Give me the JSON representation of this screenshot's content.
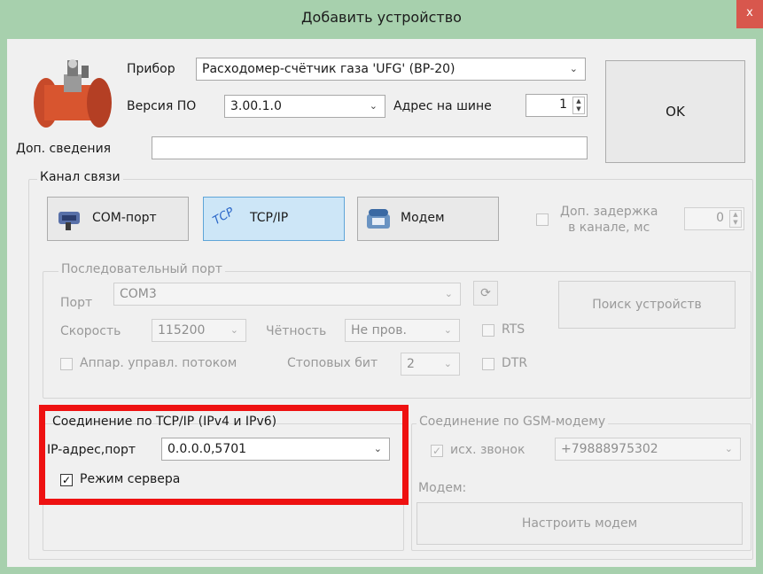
{
  "window": {
    "title": "Добавить устройство",
    "close_glyph": "x"
  },
  "device": {
    "label": "Прибор",
    "value": "Расходомер-счётчик газа 'UFG' (ВР-20)",
    "image_icon": "gas-flowmeter-image"
  },
  "firmware": {
    "label": "Версия ПО",
    "value": "3.00.1.0"
  },
  "bus_address": {
    "label": "Адрес на шине",
    "value": "1"
  },
  "ok_button": {
    "label": "OK"
  },
  "extra_info": {
    "label": "Доп. сведения",
    "value": ""
  },
  "channel": {
    "title": "Канал связи",
    "buttons": [
      {
        "label": "COM-порт",
        "icon": "serial-port-icon"
      },
      {
        "label": "TCP/IP",
        "icon": "tcp-icon",
        "icon_text": "TCP",
        "selected": true
      },
      {
        "label": "Модем",
        "icon": "phone-icon"
      }
    ],
    "delay": {
      "label_line1": "Доп. задержка",
      "label_line2": "в канале, мс",
      "value": "0",
      "checked": false
    }
  },
  "serial": {
    "title": "Последовательный порт",
    "port_label": "Порт",
    "port_value": "COM3",
    "speed_label": "Скорость",
    "speed_value": "115200",
    "parity_label": "Чётность",
    "parity_value": "Не пров.",
    "rts_label": "RTS",
    "flow_label": "Аппар. управл. потоком",
    "stop_label": "Стоповых бит",
    "stop_value": "2",
    "dtr_label": "DTR",
    "search_button": "Поиск устройств"
  },
  "tcp": {
    "title": "Соединение по TCP/IP (IPv4 и IPv6)",
    "ip_label": "IP-адрес,порт",
    "ip_value": "0.0.0.0,5701",
    "server_mode_label": "Режим сервера",
    "server_mode_checked": true
  },
  "gsm": {
    "title": "Соединение по GSM-модему",
    "outgoing_label": "исх. звонок",
    "outgoing_checked": true,
    "phone_value": "+79888975302",
    "modem_label": "Модем:",
    "setup_button": "Настроить модем"
  },
  "colors": {
    "titlebar": "#a7d0ad",
    "highlight_frame": "#ee1111",
    "selected_button": "#cde6f7"
  }
}
